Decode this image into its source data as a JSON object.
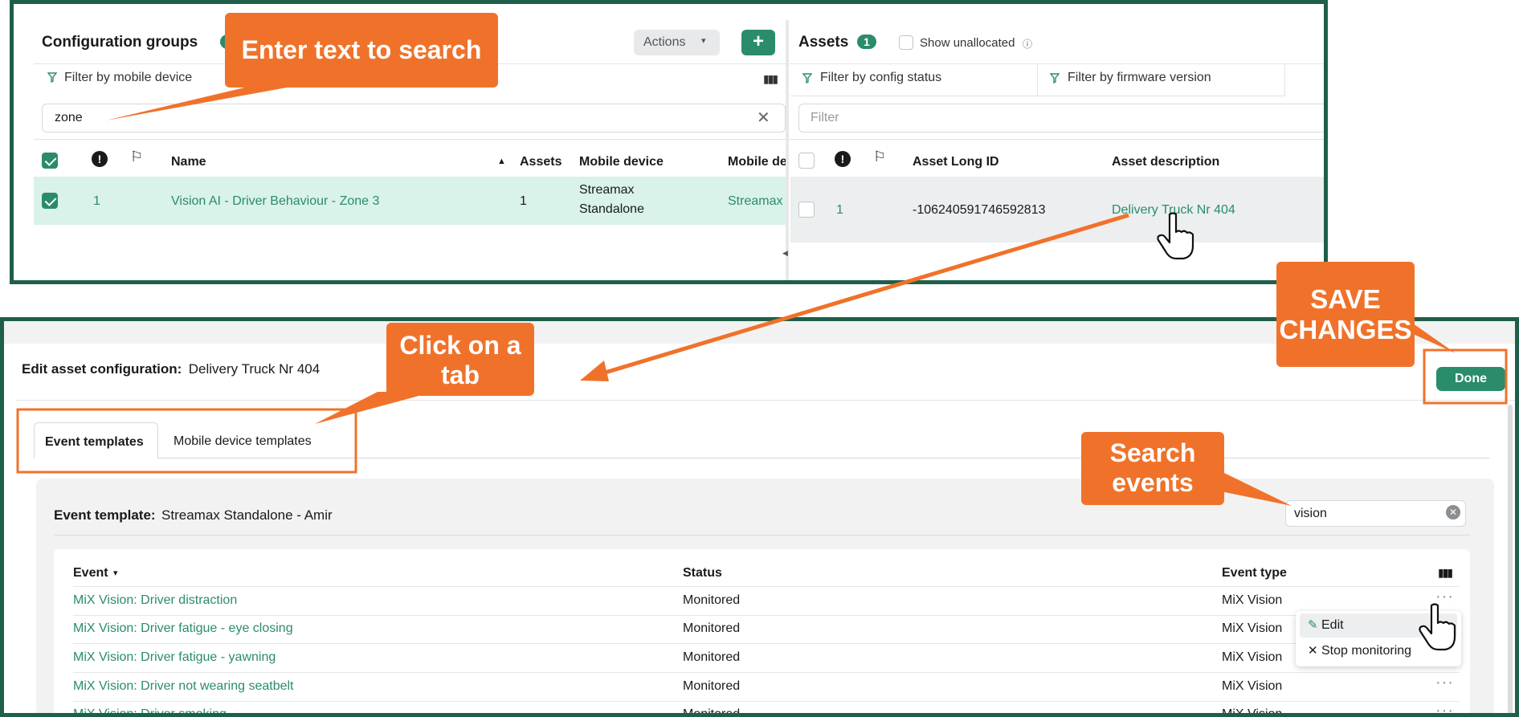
{
  "top_left": {
    "title": "Configuration groups",
    "count_badge": "1",
    "actions_label": "Actions",
    "add_symbol": "+",
    "filter_label": "Filter by mobile device",
    "search_value": "zone",
    "columns": {
      "name": "Name",
      "assets": "Assets",
      "mobile_device": "Mobile device",
      "mobile_de": "Mobile de"
    },
    "row": {
      "alert": "1",
      "name": "Vision AI - Driver Behaviour - Zone 3",
      "assets": "1",
      "mobile_line1": "Streamax",
      "mobile_line2": "Standalone",
      "mobile_trunc": "Streamax"
    }
  },
  "top_right": {
    "title": "Assets",
    "count_badge": "1",
    "show_unallocated": "Show unallocated",
    "filter_config": "Filter by config status",
    "filter_firmware": "Filter by firmware version",
    "filter_placeholder": "Filter",
    "columns": {
      "long_id": "Asset Long ID",
      "description": "Asset description"
    },
    "row": {
      "alert": "1",
      "long_id": "-106240591746592813",
      "description": "Delivery Truck Nr 404"
    }
  },
  "bottom": {
    "edit_label": "Edit asset configuration:",
    "edit_value": "Delivery Truck Nr 404",
    "done_label": "Done",
    "tabs": [
      "Event templates",
      "Mobile device templates"
    ],
    "template_label": "Event template:",
    "template_value": "Streamax Standalone - Amir",
    "search_value": "vision",
    "columns": {
      "event": "Event",
      "status": "Status",
      "event_type": "Event type"
    },
    "rows": [
      {
        "event": "MiX Vision: Driver distraction",
        "status": "Monitored",
        "type": "MiX Vision"
      },
      {
        "event": "MiX Vision: Driver fatigue - eye closing",
        "status": "Monitored",
        "type": "MiX Vision"
      },
      {
        "event": "MiX Vision: Driver fatigue - yawning",
        "status": "Monitored",
        "type": "MiX Vision"
      },
      {
        "event": "MiX Vision: Driver not wearing seatbelt",
        "status": "Monitored",
        "type": "MiX Vision"
      },
      {
        "event": "MiX Vision: Driver smoking",
        "status": "Monitored",
        "type": "MiX Vision"
      }
    ],
    "menu": {
      "edit": "Edit",
      "stop": "Stop monitoring"
    }
  },
  "callouts": {
    "enter_text": "Enter text to search",
    "click_tab_1": "Click on a",
    "click_tab_2": "tab",
    "save_1": "SAVE",
    "save_2": "CHANGES",
    "search_events_1": "Search",
    "search_events_2": "events"
  },
  "colors": {
    "accent": "#2a8c6a",
    "callout": "#f0722a",
    "frame": "#1f5f4a",
    "selected_row": "#d9f2ea"
  }
}
